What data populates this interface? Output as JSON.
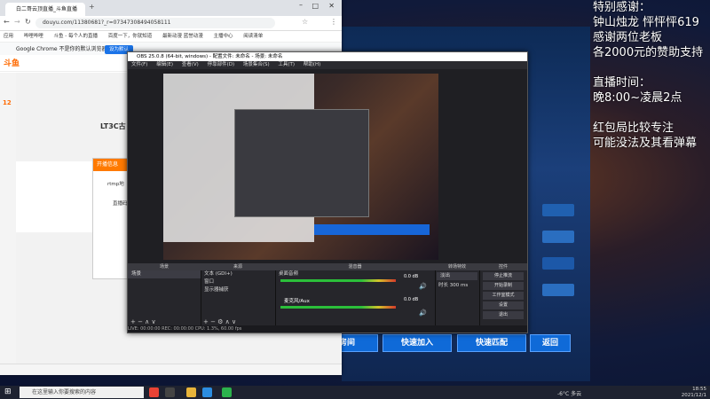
{
  "chrome": {
    "tab_title": "白二哥云顶直播_斗鱼直播",
    "url": "douyu.com/11380681?_r=07347308494058111",
    "bookmarks": [
      "应用",
      "哔哩哔哩",
      "斗鱼 - 每个人的直播",
      "百度一下，你就知道",
      "最新动漫 蓝誉动漫",
      "主播中心",
      "阅读清单"
    ],
    "infobar_text": "Google Chrome 不是你的默认浏览器",
    "infobar_button": "设为默认",
    "popup_title": "开播信息",
    "popup_line1": "rtmp地",
    "popup_line2": "直播码",
    "sidebar_count": "12",
    "live_label": "LT3C古"
  },
  "obs": {
    "title": "OBS 25.0.8 (64-bit, windows) - 配置文件: 未命名 - 场景: 未命名",
    "menu": [
      "文件(F)",
      "编辑(E)",
      "查看(V)",
      "停靠部件(D)",
      "场景集合(S)",
      "工具(T)",
      "帮助(H)"
    ],
    "docks": {
      "scenes_header": "场景",
      "scene_item": "场景",
      "sources_header": "来源",
      "sources": [
        "文本 (GDI+)",
        "窗口",
        "显示器捕获"
      ],
      "mixer_header": "混音器",
      "mixer_tracks": [
        {
          "name": "桌面音频",
          "db": "0.0 dB"
        },
        {
          "name": "麦克风/Aux",
          "db": "0.0 dB"
        }
      ],
      "transitions_header": "转场特效",
      "transition_type": "淡出",
      "duration_label": "时长",
      "duration_value": "300 ms",
      "controls_header": "控件",
      "controls": [
        "停止推流",
        "开始录制",
        "工作室模式",
        "设置",
        "退出"
      ]
    },
    "status": "LIVE: 00:00:00   REC: 00:00:00   CPU: 1.3%, 60.00 fps"
  },
  "overlay": {
    "lines": [
      "特别感谢：",
      "钟山烛龙 怦怦怦619",
      "感谢两位老板",
      "各2000元的赞助支持",
      "",
      "直播时间：",
      "晚8:00~凌晨2点",
      "",
      "红包局比较专注",
      "可能没法及其看弹幕"
    ]
  },
  "game_buttons": [
    {
      "label": "房间"
    },
    {
      "label": "快速加入"
    },
    {
      "label": "快速匹配"
    },
    {
      "label": "返回"
    }
  ],
  "taskbar": {
    "search_placeholder": "在这里输入你要搜索的内容",
    "weather": "-6°C 多云",
    "time": "18:55",
    "date": "2021/12/1"
  }
}
